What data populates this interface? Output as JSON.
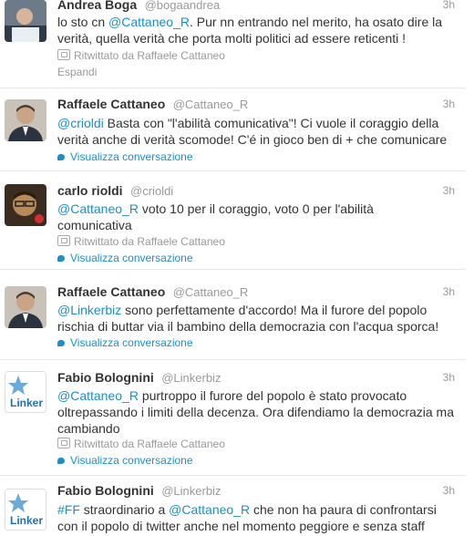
{
  "tweets": [
    {
      "name": "Andrea Boga",
      "handle": "@bogaandrea",
      "time": "3h",
      "text_lines": [
        "lo sto cn ",
        "@Cattaneo_R",
        ". Pur nn entrando nel merito, ha osato dire la",
        "verità, quella verità che porta molti politici ad essere reticenti !"
      ],
      "retweet": "Ritwittato da Raffaele Cattaneo",
      "action": "Espandi"
    },
    {
      "name": "Raffaele Cattaneo",
      "handle": "@Cattaneo_R",
      "time": "3h",
      "mention": "@crioldi",
      "text_rest": " Basta con \"l'abilità comunicativa\"! Ci vuole il coraggio della",
      "text_line2": "verità anche di verità scomode! C'é in gioco ben di + che comunicare",
      "action": "Visualizza conversazione"
    },
    {
      "name": "carlo rioldi",
      "handle": "@crioldi",
      "time": "3h",
      "mention": "@Cattaneo_R",
      "text_rest": " voto 10 per il coraggio, voto 0 per l'abilità",
      "text_line2": "comunicativa",
      "retweet": "Ritwittato da Raffaele Cattaneo",
      "action": "Visualizza conversazione"
    },
    {
      "name": "Raffaele Cattaneo",
      "handle": "@Cattaneo_R",
      "time": "3h",
      "mention": "@Linkerbiz",
      "text_rest": " sono perfettamente d'accordo! Ma il furore del popolo",
      "text_line2": "rischia di buttar via il bambino della democrazia con l'acqua sporca!",
      "action": "Visualizza conversazione"
    },
    {
      "name": "Fabio Bolognini",
      "handle": "@Linkerbiz",
      "time": "3h",
      "mention": "@Cattaneo_R",
      "text_rest": " purtroppo il furore del popolo è stato provocato",
      "text_line2": "oltrepassando i limiti della decenza. Ora difendiamo la democrazia ma",
      "text_line3": "cambiando",
      "retweet": "Ritwittato da Raffaele Cattaneo",
      "action": "Visualizza conversazione",
      "avatar_label": "Linker"
    },
    {
      "name": "Fabio Bolognini",
      "handle": "@Linkerbiz",
      "time": "3h",
      "hashtag": "#FF",
      "text_a": " straordinario a ",
      "mention": "@Cattaneo_R",
      "text_b": " che non ha paura di confrontarsi",
      "text_line2": "con il popolo di twitter anche nel momento peggiore e senza staff",
      "avatar_label": "Linker"
    }
  ],
  "colors": {
    "link": "#1b8fc7",
    "muted": "#999999",
    "text": "#333333",
    "divider": "#e8e8e8"
  }
}
